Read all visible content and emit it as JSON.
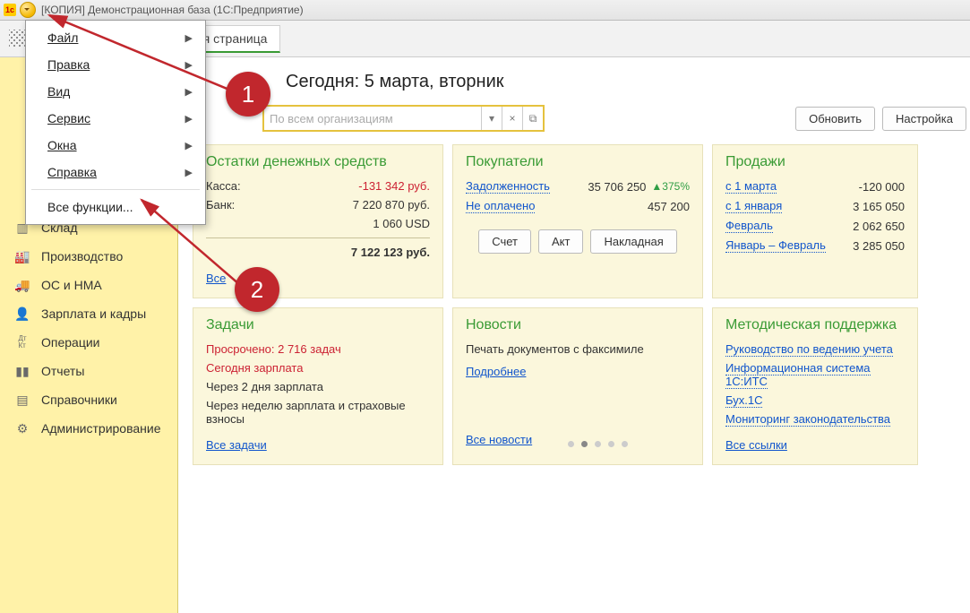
{
  "title": "[КОПИЯ]  Демонстрационная база   (1С:Предприятие)",
  "tab": "Начальная страница",
  "today": "Сегодня: 5 марта, вторник",
  "org_placeholder": "По всем организациям",
  "buttons": {
    "refresh": "Обновить",
    "settings": "Настройка"
  },
  "menu": {
    "file": "Файл",
    "edit": "Правка",
    "view": "Вид",
    "service": "Сервис",
    "windows": "Окна",
    "help": "Справка",
    "allfunc": "Все функции..."
  },
  "sidebar": [
    "Склад",
    "Производство",
    "ОС и НМА",
    "Зарплата и кадры",
    "Операции",
    "Отчеты",
    "Справочники",
    "Администрирование"
  ],
  "cash": {
    "title": "Остатки денежных средств",
    "kassa_l": "Касса:",
    "kassa_v": "-131 342 руб.",
    "bank_l": "Банк:",
    "bank_v": "7 220 870 руб.",
    "usd": "1 060 USD",
    "total": "7 122 123 руб.",
    "all": "Все"
  },
  "buyers": {
    "title": "Покупатели",
    "debt_l": "Задолженность",
    "debt_v": "35 706 250",
    "debt_delta": "▲375%",
    "unpaid_l": "Не оплачено",
    "unpaid_v": "457 200",
    "b1": "Счет",
    "b2": "Акт",
    "b3": "Накладная"
  },
  "sales": {
    "title": "Продажи",
    "r1l": "с 1 марта",
    "r1v": "-120 000",
    "r2l": "с 1 января",
    "r2v": "3 165 050",
    "r3l": "Февраль",
    "r3v": "2 062 650",
    "r4l": "Январь – Февраль",
    "r4v": "3 285 050"
  },
  "tasks": {
    "title": "Задачи",
    "overdue": "Просрочено: 2 716 задач",
    "today": "Сегодня зарплата",
    "in2": "Через 2 дня зарплата",
    "week": "Через неделю зарплата и страховые взносы",
    "all": "Все задачи"
  },
  "news": {
    "title": "Новости",
    "line": "Печать документов с факсимиле",
    "more": "Подробнее",
    "all": "Все новости"
  },
  "support": {
    "title": "Методическая поддержка",
    "l1": "Руководство по ведению учета",
    "l2": "Информационная система 1С:ИТС",
    "l3": "Бух.1С",
    "l4": "Мониторинг законодательства",
    "all": "Все ссылки"
  },
  "callouts": {
    "c1": "1",
    "c2": "2"
  }
}
